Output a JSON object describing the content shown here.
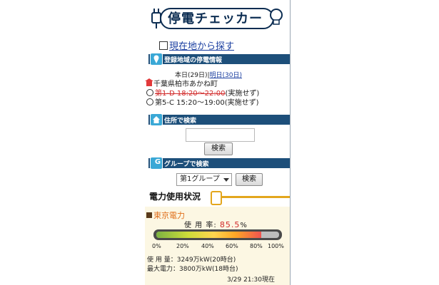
{
  "app": {
    "title": "停電チェッカー",
    "locate_label": "現在地から探す"
  },
  "sections": {
    "info_title": "登録地域の停電情報",
    "address_search_title": "住所で検索",
    "group_search_title": "グループで検索"
  },
  "outage": {
    "today": "本日(29日)",
    "separator": "|",
    "tomorrow": "明日(30日)",
    "location": "千葉県柏市あかね町",
    "plans": [
      {
        "text": "第1-D 18:20～22:00",
        "status": "(実施せず)"
      },
      {
        "text": "第5-C 15:20～19:00",
        "status": "(実施せず)"
      }
    ]
  },
  "address_search": {
    "button_label": "検索",
    "input_value": ""
  },
  "group_search": {
    "selected_group": "第1グループ",
    "button_label": "検索"
  },
  "power": {
    "title": "電力使用状況",
    "company": "東京電力",
    "rate_label": "使 用 率:",
    "rate_value": "85.5",
    "rate_unit": "%",
    "ticks": [
      "0%",
      "20%",
      "40%",
      "60%",
      "80%",
      "100%"
    ],
    "usage_line": "使 用 量：3249万kW(20時台)",
    "max_line": "最大電力：3800万kW(18時台)",
    "timestamp": "3/29 21:30現在",
    "fill_fraction": 0.855
  },
  "colors": {
    "header_bg": "#1d4f7a",
    "accent_blue": "#3aa8d6",
    "plug_yellow": "#e3a61d",
    "alert_red": "#d12a2a",
    "company_orange": "#e06f1a"
  }
}
